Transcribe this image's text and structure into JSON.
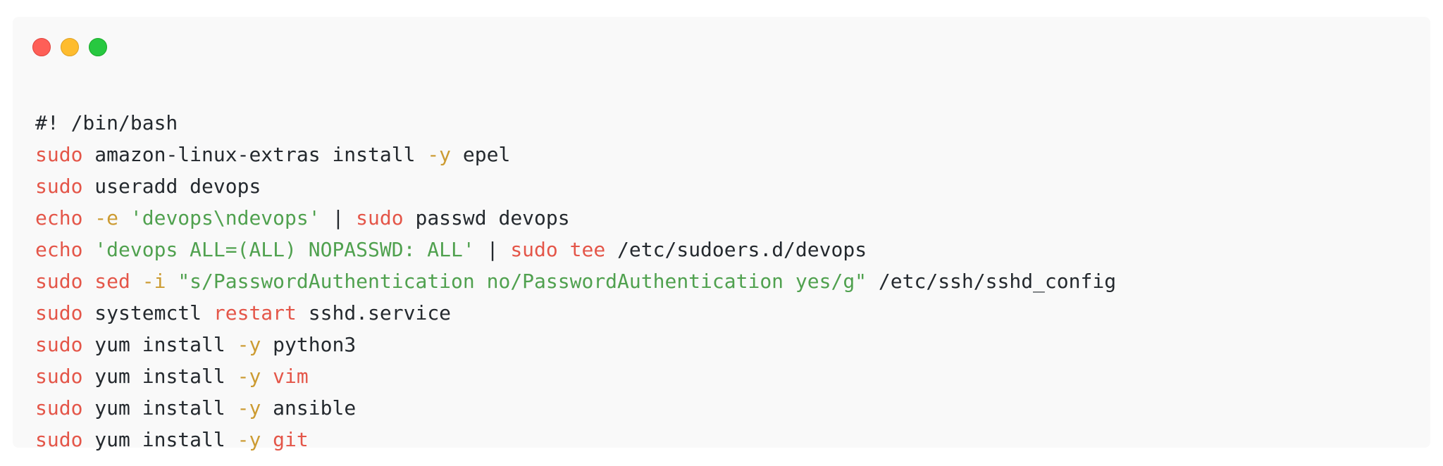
{
  "colors": {
    "cmd": "#e45649",
    "flag": "#c18401",
    "string": "#50a14f",
    "plain": "#24292e",
    "background": "#f9f9f9"
  },
  "window_controls": [
    {
      "name": "close",
      "color": "#fe5f57"
    },
    {
      "name": "minimize",
      "color": "#febc2e"
    },
    {
      "name": "maximize",
      "color": "#27c840"
    }
  ],
  "code": {
    "language": "bash",
    "lines": [
      [
        {
          "t": "plain",
          "v": "#! /bin/bash"
        }
      ],
      [
        {
          "t": "cmd",
          "v": "sudo"
        },
        {
          "t": "plain",
          "v": " amazon-linux-extras install "
        },
        {
          "t": "flag",
          "v": "-y"
        },
        {
          "t": "plain",
          "v": " epel"
        }
      ],
      [
        {
          "t": "cmd",
          "v": "sudo"
        },
        {
          "t": "plain",
          "v": " useradd devops"
        }
      ],
      [
        {
          "t": "cmd",
          "v": "echo"
        },
        {
          "t": "plain",
          "v": " "
        },
        {
          "t": "flag",
          "v": "-e"
        },
        {
          "t": "plain",
          "v": " "
        },
        {
          "t": "str",
          "v": "'devops\\ndevops'"
        },
        {
          "t": "plain",
          "v": " | "
        },
        {
          "t": "cmd",
          "v": "sudo"
        },
        {
          "t": "plain",
          "v": " passwd devops"
        }
      ],
      [
        {
          "t": "cmd",
          "v": "echo"
        },
        {
          "t": "plain",
          "v": " "
        },
        {
          "t": "str",
          "v": "'devops ALL=(ALL) NOPASSWD: ALL'"
        },
        {
          "t": "plain",
          "v": " | "
        },
        {
          "t": "cmd",
          "v": "sudo"
        },
        {
          "t": "plain",
          "v": " "
        },
        {
          "t": "cmd",
          "v": "tee"
        },
        {
          "t": "plain",
          "v": " /etc/sudoers.d/devops"
        }
      ],
      [
        {
          "t": "cmd",
          "v": "sudo"
        },
        {
          "t": "plain",
          "v": " "
        },
        {
          "t": "cmd",
          "v": "sed"
        },
        {
          "t": "plain",
          "v": " "
        },
        {
          "t": "flag",
          "v": "-i"
        },
        {
          "t": "plain",
          "v": " "
        },
        {
          "t": "str",
          "v": "\"s/PasswordAuthentication no/PasswordAuthentication yes/g\""
        },
        {
          "t": "plain",
          "v": " /etc/ssh/sshd_config"
        }
      ],
      [
        {
          "t": "cmd",
          "v": "sudo"
        },
        {
          "t": "plain",
          "v": " systemctl "
        },
        {
          "t": "cmd",
          "v": "restart"
        },
        {
          "t": "plain",
          "v": " sshd.service"
        }
      ],
      [
        {
          "t": "cmd",
          "v": "sudo"
        },
        {
          "t": "plain",
          "v": " yum install "
        },
        {
          "t": "flag",
          "v": "-y"
        },
        {
          "t": "plain",
          "v": " python3"
        }
      ],
      [
        {
          "t": "cmd",
          "v": "sudo"
        },
        {
          "t": "plain",
          "v": " yum install "
        },
        {
          "t": "flag",
          "v": "-y"
        },
        {
          "t": "plain",
          "v": " "
        },
        {
          "t": "cmd",
          "v": "vim"
        }
      ],
      [
        {
          "t": "cmd",
          "v": "sudo"
        },
        {
          "t": "plain",
          "v": " yum install "
        },
        {
          "t": "flag",
          "v": "-y"
        },
        {
          "t": "plain",
          "v": " ansible"
        }
      ],
      [
        {
          "t": "cmd",
          "v": "sudo"
        },
        {
          "t": "plain",
          "v": " yum install "
        },
        {
          "t": "flag",
          "v": "-y"
        },
        {
          "t": "plain",
          "v": " "
        },
        {
          "t": "cmd",
          "v": "git"
        }
      ]
    ]
  }
}
